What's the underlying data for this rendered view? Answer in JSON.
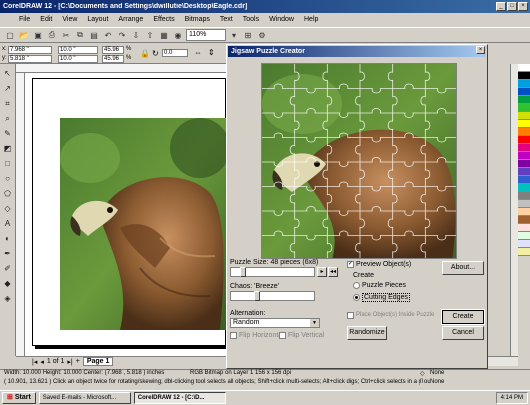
{
  "window": {
    "title": "CorelDRAW 12 - [C:\\Documents and Settings\\dwillutie\\Desktop\\Eagle.cdr]",
    "controls": [
      "_",
      "□",
      "×"
    ]
  },
  "menu": [
    "File",
    "Edit",
    "View",
    "Layout",
    "Arrange",
    "Effects",
    "Bitmaps",
    "Text",
    "Tools",
    "Window",
    "Help"
  ],
  "toolbar": {
    "zoom": "110%"
  },
  "propbar": {
    "x": "7.968 \"",
    "y": "5.818 \"",
    "w": "10.0 \"",
    "h": "10.0 \"",
    "sx": "45.96",
    "sy": "45.96",
    "pct": "%",
    "angle": "0.0"
  },
  "document": {
    "page_info": "1 of 1",
    "page_tab": "Page 1"
  },
  "dialog": {
    "title": "Jigsaw Puzzle Creator",
    "close": "×",
    "puzzle_size_label": "Puzzle Size: 48 pieces (6x8)",
    "puzzle_size_value": 0.12,
    "chaos_label": "Chaos: 'Breeze'",
    "chaos_value": 0.3,
    "alternation_label": "Alternation:",
    "alternation_value": "Random",
    "flip_horizontal": "Flip Horizontal",
    "flip_vertical": "Flip Vertical",
    "preview_objects": "Preview Object(s)",
    "create_group": "Create",
    "puzzle_pieces": "Puzzle Pieces",
    "cutting_edges": "Cutting Edges",
    "place_inside": "Place Object(s) Inside Puzzle",
    "about": "About...",
    "randomize": "Randomize",
    "create": "Create",
    "cancel": "Cancel",
    "grid": {
      "cols": 6,
      "rows": 8
    }
  },
  "status": {
    "line1": "Width: 10.000  Height: 10.000  Center: (7.968 , 5.818 )  inches",
    "bitmap_info": "RGB Bitmap on Layer 1 156 x 156 dpi",
    "fill": "None",
    "line2": "( 10.901, 13.621 )     Click an object twice for rotating/skewing; dbl-clicking tool selects all objects; Shift+click multi-selects; Alt+click digs; Ctrl+click selects in a group",
    "outline": "None"
  },
  "taskbar": {
    "start": "Start",
    "tasks": [
      "Saved E-mails - Microsoft...",
      "CorelDRAW 12 - [C:\\D..."
    ],
    "clock": "4:14 PM"
  },
  "palette": [
    "#ffffff",
    "#000000",
    "#00a0e0",
    "#0050c8",
    "#00a040",
    "#30c030",
    "#d0e000",
    "#ffff00",
    "#ff8000",
    "#ff0000",
    "#e00080",
    "#c000c0",
    "#8000a0",
    "#6040c0",
    "#3060d0",
    "#00c0c0",
    "#808080",
    "#c0c0c0",
    "#ffd0a0",
    "#a06030",
    "#ffe0e0",
    "#e0ffe0",
    "#e0e0ff",
    "#f0f0a0"
  ]
}
